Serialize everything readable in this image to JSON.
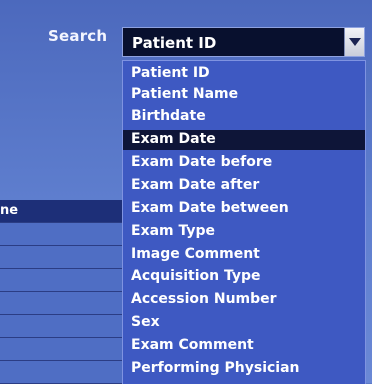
{
  "search": {
    "label": "Search",
    "selected": "Patient ID"
  },
  "left_table": {
    "row_label": "ne"
  },
  "dropdown": {
    "options": [
      "Patient ID",
      "Patient Name",
      "Birthdate",
      "Exam Date",
      "Exam Date before",
      "Exam Date after",
      "Exam Date between",
      "Exam Type",
      "Image Comment",
      "Acquisition Type",
      "Accession Number",
      "Sex",
      "Exam Comment",
      "Performing Physician"
    ],
    "highlighted": "Exam Date"
  }
}
